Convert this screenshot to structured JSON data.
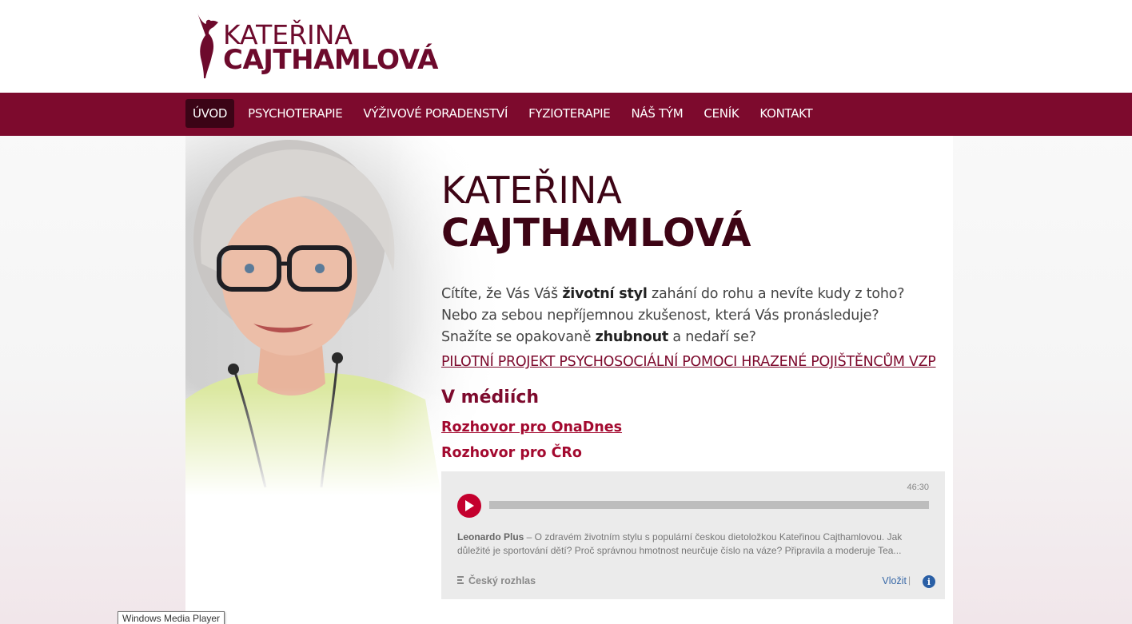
{
  "logo": {
    "line1": "KATEŘINA",
    "line2": "CAJTHAMLOVÁ"
  },
  "nav": {
    "items": [
      {
        "label": "ÚVOD",
        "active": true
      },
      {
        "label": "PSYCHOTERAPIE",
        "active": false
      },
      {
        "label": "VÝŽIVOVÉ PORADENSTVÍ",
        "active": false
      },
      {
        "label": "FYZIOTERAPIE",
        "active": false
      },
      {
        "label": "NÁŠ TÝM",
        "active": false
      },
      {
        "label": "CENÍK",
        "active": false
      },
      {
        "label": "KONTAKT",
        "active": false
      }
    ]
  },
  "hero": {
    "name_first": "KATEŘINA",
    "name_last": "CAJTHAMLOVÁ"
  },
  "intro": {
    "line1_pre": "Cítíte, že Vás Váš ",
    "line1_bold": "životní styl",
    "line1_post": " zahání do rohu a nevíte kudy z toho?",
    "line2": "Nebo za sebou nepříjemnou zkušenost, která Vás pronásleduje?",
    "line3_pre": "Snažíte se opakovaně ",
    "line3_bold": "zhubnout",
    "line3_post": " a nedaří se?"
  },
  "vzp_link": "PILOTNÍ PROJEKT PSYCHOSOCIÁLNÍ POMOCI HRAZENÉ POJIŠTĚNCŮM VZP",
  "media": {
    "heading": "V médiích",
    "link1": "Rozhovor pro OnaDnes",
    "link2": "Rozhovor pro ČRo"
  },
  "player": {
    "duration": "46:30",
    "show": "Leonardo Plus",
    "description": " – O zdravém životním stylu s populární českou dietoložkou Kateřinou Cajthamlovou. Jak důležité je sportování dětí? Proč správnou hmotnost neurčuje číslo na váze? Připravila a moderuje Tea...",
    "source": "Český rozhlas",
    "embed_label": "Vložit",
    "separator": "|",
    "info_glyph": "i"
  },
  "tooltip": "Windows Media Player",
  "colors": {
    "brand": "#7d0a2d",
    "brand_dark": "#3e0415",
    "nav_active": "#3b0416",
    "link": "#a3092f",
    "play": "#c4002e",
    "info": "#2a5fa5"
  }
}
